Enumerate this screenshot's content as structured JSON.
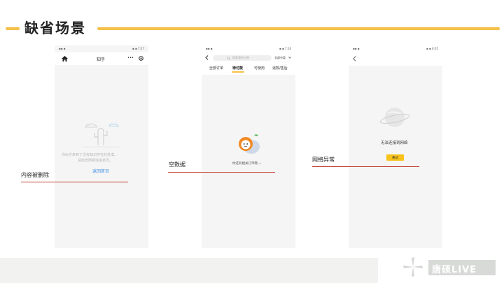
{
  "title": "缺省场景",
  "phones": [
    {
      "status_left": "▪▪ ▪",
      "status_right": "▪ ▪ 7:27",
      "nav_title": "知乎",
      "nav_dots": "•••",
      "message_line1": "你似乎来到了没有知识存在的荒漠…",
      "message_line2": "请检查网络连接状况。",
      "link": "返回首页"
    },
    {
      "status_left": "▪▪ ▪",
      "status_right": "▪ ▪ 7:16",
      "search_placeholder": "搜索我的订单",
      "filter_label": "全部分类",
      "tabs": [
        "全部订单",
        "待付款",
        "可使用",
        "退款/售后"
      ],
      "message": "你还有相关订单哦 ~"
    },
    {
      "status_left": "▪▪ ▪",
      "status_right": "▪ ▪ 6:05",
      "message": "无法连接到网络",
      "button": "重试"
    }
  ],
  "captions": [
    "内容被删除",
    "空数据",
    "网络异常"
  ],
  "logo": "唐硕LIVE",
  "colors": {
    "accent": "#f5c14a",
    "link": "#3d8fe0",
    "caption_line": "#c0392b",
    "retry": "#f7c21a"
  }
}
